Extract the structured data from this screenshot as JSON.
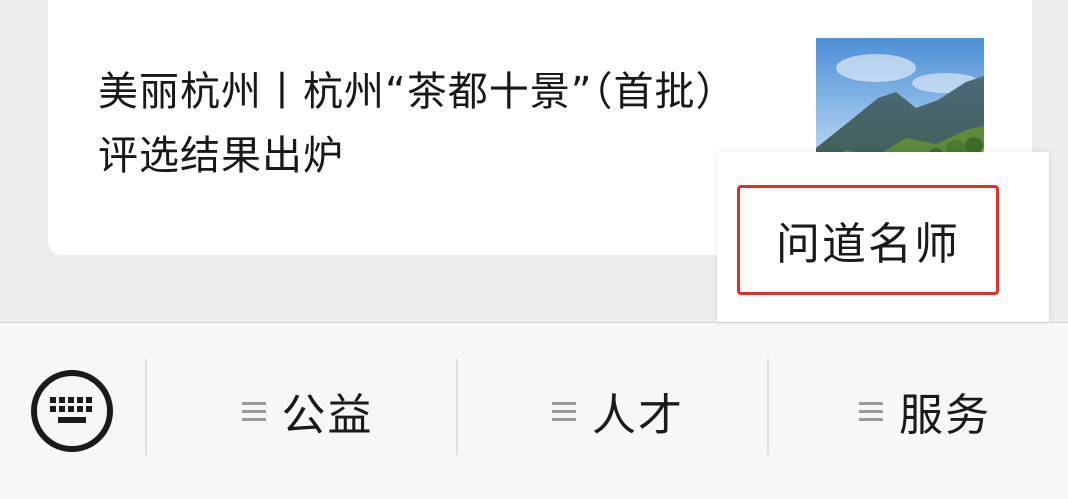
{
  "article": {
    "title": "美丽杭州丨杭州“茶都十景”（首批）评选结果出炉",
    "thumbnail_icon": "mountain-landscape-image"
  },
  "popup": {
    "item_label": "问道名师",
    "highlight_color": "#e0302c"
  },
  "menubar": {
    "keyboard_icon": "keyboard-icon",
    "items": [
      {
        "label": "公益",
        "icon": "menu-lines-icon"
      },
      {
        "label": "人才",
        "icon": "menu-lines-icon"
      },
      {
        "label": "服务",
        "icon": "menu-lines-icon"
      }
    ]
  }
}
